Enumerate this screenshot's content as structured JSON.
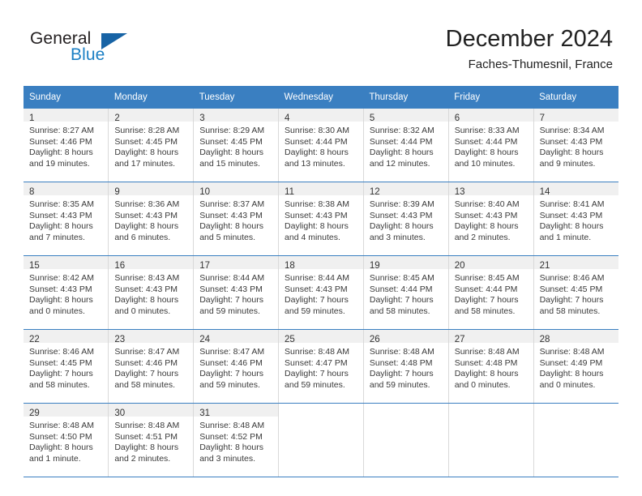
{
  "logo": {
    "word_one": "General",
    "word_two": "Blue",
    "triangle_color": "#1763a5",
    "blue_color": "#1b7fc4"
  },
  "header": {
    "title": "December 2024",
    "subtitle": "Faches-Thumesnil, France"
  },
  "theme": {
    "header_row_bg": "#3a7fc1",
    "header_row_text": "#ffffff",
    "daynum_band_bg": "#f0f0f0",
    "week_separator": "#3a7fc1",
    "cell_divider": "#d9d9d9"
  },
  "calendar": {
    "weekday_headers": [
      "Sunday",
      "Monday",
      "Tuesday",
      "Wednesday",
      "Thursday",
      "Friday",
      "Saturday"
    ],
    "weeks": [
      [
        {
          "day": "1",
          "sunrise": "Sunrise: 8:27 AM",
          "sunset": "Sunset: 4:46 PM",
          "daylight_1": "Daylight: 8 hours",
          "daylight_2": "and 19 minutes."
        },
        {
          "day": "2",
          "sunrise": "Sunrise: 8:28 AM",
          "sunset": "Sunset: 4:45 PM",
          "daylight_1": "Daylight: 8 hours",
          "daylight_2": "and 17 minutes."
        },
        {
          "day": "3",
          "sunrise": "Sunrise: 8:29 AM",
          "sunset": "Sunset: 4:45 PM",
          "daylight_1": "Daylight: 8 hours",
          "daylight_2": "and 15 minutes."
        },
        {
          "day": "4",
          "sunrise": "Sunrise: 8:30 AM",
          "sunset": "Sunset: 4:44 PM",
          "daylight_1": "Daylight: 8 hours",
          "daylight_2": "and 13 minutes."
        },
        {
          "day": "5",
          "sunrise": "Sunrise: 8:32 AM",
          "sunset": "Sunset: 4:44 PM",
          "daylight_1": "Daylight: 8 hours",
          "daylight_2": "and 12 minutes."
        },
        {
          "day": "6",
          "sunrise": "Sunrise: 8:33 AM",
          "sunset": "Sunset: 4:44 PM",
          "daylight_1": "Daylight: 8 hours",
          "daylight_2": "and 10 minutes."
        },
        {
          "day": "7",
          "sunrise": "Sunrise: 8:34 AM",
          "sunset": "Sunset: 4:43 PM",
          "daylight_1": "Daylight: 8 hours",
          "daylight_2": "and 9 minutes."
        }
      ],
      [
        {
          "day": "8",
          "sunrise": "Sunrise: 8:35 AM",
          "sunset": "Sunset: 4:43 PM",
          "daylight_1": "Daylight: 8 hours",
          "daylight_2": "and 7 minutes."
        },
        {
          "day": "9",
          "sunrise": "Sunrise: 8:36 AM",
          "sunset": "Sunset: 4:43 PM",
          "daylight_1": "Daylight: 8 hours",
          "daylight_2": "and 6 minutes."
        },
        {
          "day": "10",
          "sunrise": "Sunrise: 8:37 AM",
          "sunset": "Sunset: 4:43 PM",
          "daylight_1": "Daylight: 8 hours",
          "daylight_2": "and 5 minutes."
        },
        {
          "day": "11",
          "sunrise": "Sunrise: 8:38 AM",
          "sunset": "Sunset: 4:43 PM",
          "daylight_1": "Daylight: 8 hours",
          "daylight_2": "and 4 minutes."
        },
        {
          "day": "12",
          "sunrise": "Sunrise: 8:39 AM",
          "sunset": "Sunset: 4:43 PM",
          "daylight_1": "Daylight: 8 hours",
          "daylight_2": "and 3 minutes."
        },
        {
          "day": "13",
          "sunrise": "Sunrise: 8:40 AM",
          "sunset": "Sunset: 4:43 PM",
          "daylight_1": "Daylight: 8 hours",
          "daylight_2": "and 2 minutes."
        },
        {
          "day": "14",
          "sunrise": "Sunrise: 8:41 AM",
          "sunset": "Sunset: 4:43 PM",
          "daylight_1": "Daylight: 8 hours",
          "daylight_2": "and 1 minute."
        }
      ],
      [
        {
          "day": "15",
          "sunrise": "Sunrise: 8:42 AM",
          "sunset": "Sunset: 4:43 PM",
          "daylight_1": "Daylight: 8 hours",
          "daylight_2": "and 0 minutes."
        },
        {
          "day": "16",
          "sunrise": "Sunrise: 8:43 AM",
          "sunset": "Sunset: 4:43 PM",
          "daylight_1": "Daylight: 8 hours",
          "daylight_2": "and 0 minutes."
        },
        {
          "day": "17",
          "sunrise": "Sunrise: 8:44 AM",
          "sunset": "Sunset: 4:43 PM",
          "daylight_1": "Daylight: 7 hours",
          "daylight_2": "and 59 minutes."
        },
        {
          "day": "18",
          "sunrise": "Sunrise: 8:44 AM",
          "sunset": "Sunset: 4:43 PM",
          "daylight_1": "Daylight: 7 hours",
          "daylight_2": "and 59 minutes."
        },
        {
          "day": "19",
          "sunrise": "Sunrise: 8:45 AM",
          "sunset": "Sunset: 4:44 PM",
          "daylight_1": "Daylight: 7 hours",
          "daylight_2": "and 58 minutes."
        },
        {
          "day": "20",
          "sunrise": "Sunrise: 8:45 AM",
          "sunset": "Sunset: 4:44 PM",
          "daylight_1": "Daylight: 7 hours",
          "daylight_2": "and 58 minutes."
        },
        {
          "day": "21",
          "sunrise": "Sunrise: 8:46 AM",
          "sunset": "Sunset: 4:45 PM",
          "daylight_1": "Daylight: 7 hours",
          "daylight_2": "and 58 minutes."
        }
      ],
      [
        {
          "day": "22",
          "sunrise": "Sunrise: 8:46 AM",
          "sunset": "Sunset: 4:45 PM",
          "daylight_1": "Daylight: 7 hours",
          "daylight_2": "and 58 minutes."
        },
        {
          "day": "23",
          "sunrise": "Sunrise: 8:47 AM",
          "sunset": "Sunset: 4:46 PM",
          "daylight_1": "Daylight: 7 hours",
          "daylight_2": "and 58 minutes."
        },
        {
          "day": "24",
          "sunrise": "Sunrise: 8:47 AM",
          "sunset": "Sunset: 4:46 PM",
          "daylight_1": "Daylight: 7 hours",
          "daylight_2": "and 59 minutes."
        },
        {
          "day": "25",
          "sunrise": "Sunrise: 8:48 AM",
          "sunset": "Sunset: 4:47 PM",
          "daylight_1": "Daylight: 7 hours",
          "daylight_2": "and 59 minutes."
        },
        {
          "day": "26",
          "sunrise": "Sunrise: 8:48 AM",
          "sunset": "Sunset: 4:48 PM",
          "daylight_1": "Daylight: 7 hours",
          "daylight_2": "and 59 minutes."
        },
        {
          "day": "27",
          "sunrise": "Sunrise: 8:48 AM",
          "sunset": "Sunset: 4:48 PM",
          "daylight_1": "Daylight: 8 hours",
          "daylight_2": "and 0 minutes."
        },
        {
          "day": "28",
          "sunrise": "Sunrise: 8:48 AM",
          "sunset": "Sunset: 4:49 PM",
          "daylight_1": "Daylight: 8 hours",
          "daylight_2": "and 0 minutes."
        }
      ],
      [
        {
          "day": "29",
          "sunrise": "Sunrise: 8:48 AM",
          "sunset": "Sunset: 4:50 PM",
          "daylight_1": "Daylight: 8 hours",
          "daylight_2": "and 1 minute."
        },
        {
          "day": "30",
          "sunrise": "Sunrise: 8:48 AM",
          "sunset": "Sunset: 4:51 PM",
          "daylight_1": "Daylight: 8 hours",
          "daylight_2": "and 2 minutes."
        },
        {
          "day": "31",
          "sunrise": "Sunrise: 8:48 AM",
          "sunset": "Sunset: 4:52 PM",
          "daylight_1": "Daylight: 8 hours",
          "daylight_2": "and 3 minutes."
        },
        {
          "day": "",
          "sunrise": "",
          "sunset": "",
          "daylight_1": "",
          "daylight_2": ""
        },
        {
          "day": "",
          "sunrise": "",
          "sunset": "",
          "daylight_1": "",
          "daylight_2": ""
        },
        {
          "day": "",
          "sunrise": "",
          "sunset": "",
          "daylight_1": "",
          "daylight_2": ""
        },
        {
          "day": "",
          "sunrise": "",
          "sunset": "",
          "daylight_1": "",
          "daylight_2": ""
        }
      ]
    ]
  }
}
